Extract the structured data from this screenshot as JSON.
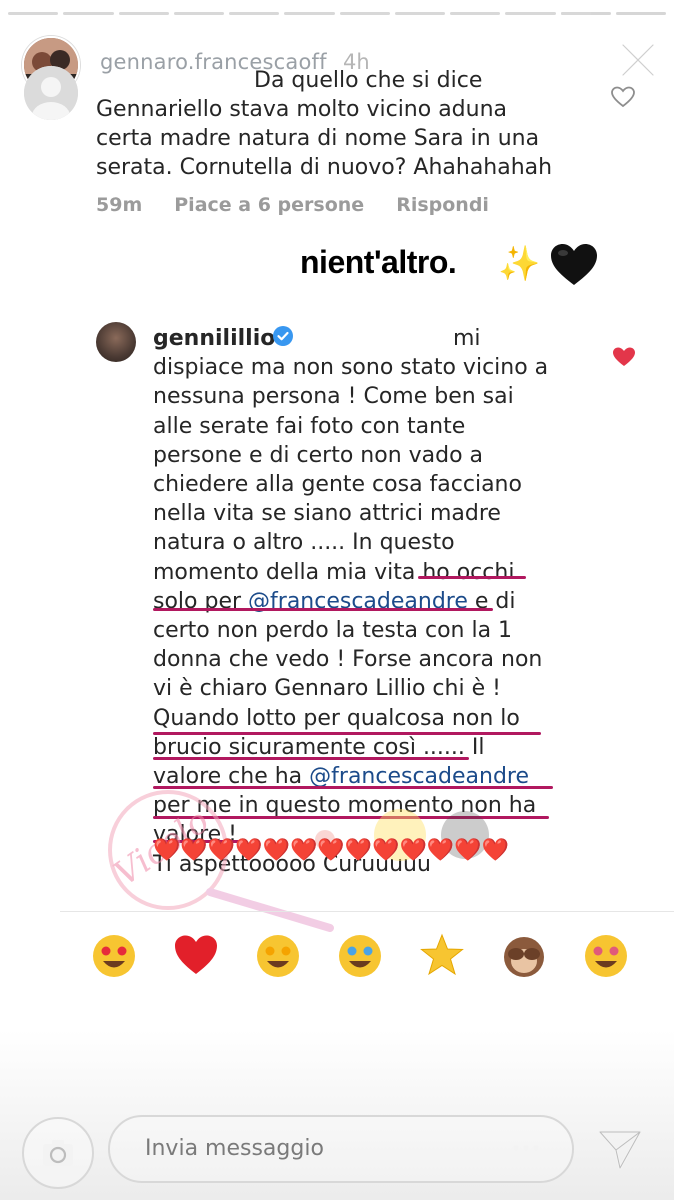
{
  "story": {
    "progress": [
      1,
      1,
      1,
      1,
      1,
      1,
      1,
      1,
      1,
      1,
      0.6,
      0
    ],
    "username": "gennaro.francescaoff",
    "time": "4h"
  },
  "comment1": {
    "lines": [
      "Da quello che si dice",
      "Gennariello stava molto vicino aduna",
      "certa madre natura di nome Sara in una",
      "serata. Cornutella di nuovo? Ahahahahah"
    ],
    "time": "59m",
    "likes": "Piace a 6 persone",
    "reply": "Rispondi"
  },
  "overlay": {
    "text": "nient'altro.",
    "sparkle": "✨",
    "heart_color": "#111111"
  },
  "comment2": {
    "username": "gennilillio",
    "first": "mi",
    "lines": [
      "dispiace ma non sono stato vicino a",
      "nessuna persona ! Come ben sai",
      "alle serate fai foto con tante",
      "persone e di certo non vado a",
      "chiedere alla gente cosa facciano",
      "nella vita se siano attrici madre",
      "natura o altro ..... In questo",
      "momento della mia vita ho occhi",
      "solo per @francescadeandre  e di",
      "certo non perdo la testa con la 1",
      "donna che vedo ! Forse ancora non",
      "vi è chiaro Gennaro Lillio chi è !",
      "Quando lotto per qualcosa non lo",
      "brucio sicuramente così ...... Il",
      "valore che ha @francescadeandre",
      "per me in questo momento non ha",
      "valore !",
      "Ti aspettooooo Curuuuuu"
    ],
    "mention": "@francescadeandre",
    "hearts": "❤️❤️❤️❤️❤️❤️❤️❤️❤️❤️❤️❤️❤️"
  },
  "emoji_bar": [
    {
      "icon": "heart-eyes-emoji",
      "char": "😍"
    },
    {
      "icon": "red-heart-emoji",
      "char": "❤️"
    },
    {
      "icon": "star-struck-emoji",
      "char": "🤩"
    },
    {
      "icon": "tears-of-joy-emoji",
      "char": "😂"
    },
    {
      "icon": "glowing-star-emoji",
      "char": "🌟"
    },
    {
      "icon": "see-no-evil-monkey-emoji",
      "char": "🙈"
    },
    {
      "icon": "zany-face-emoji",
      "char": "🤪"
    }
  ],
  "input": {
    "placeholder": "Invia messaggio"
  },
  "colors": {
    "highlight": "#b1185f",
    "liked_heart": "#e3364a",
    "verified": "#3897f0"
  }
}
